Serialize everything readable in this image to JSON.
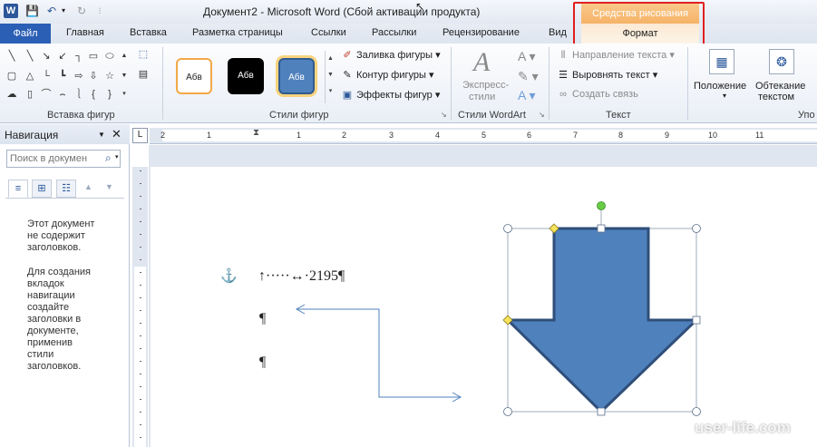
{
  "window": {
    "title": "Документ2  -  Microsoft Word (Сбой активации продукта)",
    "context_header": "Средства рисования",
    "qat": {
      "logo": "W"
    }
  },
  "tabs": {
    "file": "Файл",
    "items": [
      "Главная",
      "Вставка",
      "Разметка страницы",
      "Ссылки",
      "Рассылки",
      "Рецензирование",
      "Вид"
    ],
    "active_context": "Формат"
  },
  "ribbon": {
    "groups": {
      "insert_shapes": "Вставка фигур",
      "shape_styles": "Стили фигур",
      "wordart_styles": "Стили WordArt",
      "text": "Текст",
      "arrange_partial": "Упо"
    },
    "style_samples": [
      "Абв",
      "Абв",
      "Абв"
    ],
    "shape_commands": {
      "fill": "Заливка фигуры",
      "outline": "Контур фигуры",
      "effects": "Эффекты фигур"
    },
    "wordart": {
      "express_line1": "Экспресс-",
      "express_line2": "стили"
    },
    "text_commands": {
      "direction": "Направление текста",
      "align": "Выровнять текст",
      "link": "Создать связь"
    },
    "arrange": {
      "position": "Положение",
      "wrap_line1": "Обтекание",
      "wrap_line2": "текстом"
    }
  },
  "navigation": {
    "title": "Навигация",
    "search_placeholder": "Поиск в докумен",
    "message1": "Этот документ не содержит заголовков.",
    "message2": "Для создания вкладок навигации создайте заголовки в документе, применив стили заголовков."
  },
  "ruler": {
    "corner": "L",
    "numbers": [
      "2",
      "1",
      "1",
      "2",
      "3",
      "4",
      "5",
      "6",
      "7",
      "8",
      "9",
      "10",
      "11"
    ]
  },
  "document": {
    "line1": "↑·····↔·2195¶",
    "line2": "¶",
    "line3": "¶"
  },
  "colors": {
    "arrow_fill": "#4f81bd",
    "arrow_stroke": "#2f4f7a",
    "file_tab": "#2b5fb5",
    "context_header": "#f6b266",
    "highlight": "#e02020",
    "connector": "#4f81bd"
  },
  "watermark": "user-life.com"
}
